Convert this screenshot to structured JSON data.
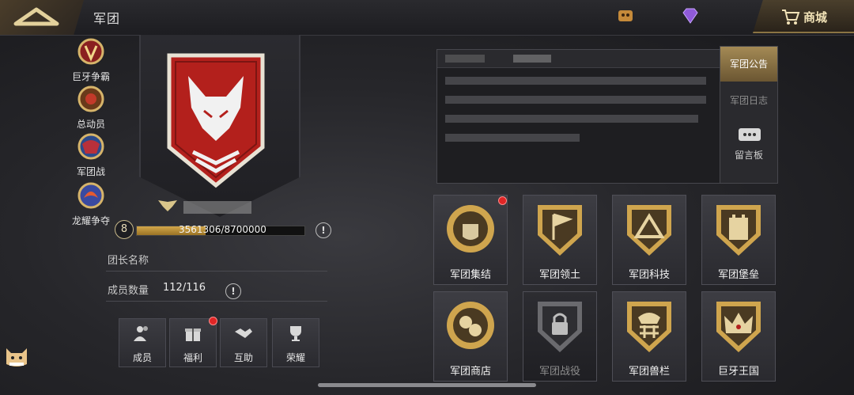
{
  "header": {
    "title": "军团",
    "shop_label": "商城",
    "resource_1": "",
    "resource_2": "",
    "icons": [
      "back-icon",
      "coin-icon",
      "diamond-icon",
      "cart-icon"
    ]
  },
  "side_menu": {
    "items": [
      {
        "label": "巨牙争霸",
        "icon": "fang-contest-icon"
      },
      {
        "label": "总动员",
        "icon": "mobilize-icon"
      },
      {
        "label": "军团战",
        "icon": "legion-war-icon"
      },
      {
        "label": "龙耀争夺",
        "icon": "dragon-glory-icon"
      }
    ]
  },
  "legion": {
    "level": "8",
    "experience_text": "3561306/8700000",
    "experience_current": 3561306,
    "experience_max": 8700000,
    "leader_label": "团长名称",
    "leader_value": "",
    "members_label": "成员数量",
    "members_value": "112/116"
  },
  "bottom_buttons": [
    {
      "label": "成员",
      "icon": "members-icon"
    },
    {
      "label": "福利",
      "icon": "gift-icon",
      "notification": true
    },
    {
      "label": "互助",
      "icon": "handshake-icon"
    },
    {
      "label": "荣耀",
      "icon": "trophy-icon"
    }
  ],
  "tabs": [
    {
      "label": "军团公告",
      "active": true
    },
    {
      "label": "军团日志",
      "active": false
    },
    {
      "label": "留言板",
      "active": false
    }
  ],
  "features": [
    {
      "label": "军团集结",
      "icon": "fist-icon",
      "notification": true
    },
    {
      "label": "军团领土",
      "icon": "territory-flag-icon"
    },
    {
      "label": "军团科技",
      "icon": "tech-triangle-icon"
    },
    {
      "label": "军团堡垒",
      "icon": "fortress-icon"
    },
    {
      "label": "军团商店",
      "icon": "shop-coins-icon"
    },
    {
      "label": "军团战役",
      "icon": "locked-campaign-icon",
      "locked": true
    },
    {
      "label": "军团兽栏",
      "icon": "beast-pen-icon"
    },
    {
      "label": "巨牙王国",
      "icon": "crown-icon"
    }
  ],
  "colors": {
    "accent_gold": "#c9a45a",
    "notification_red": "#e02525"
  }
}
